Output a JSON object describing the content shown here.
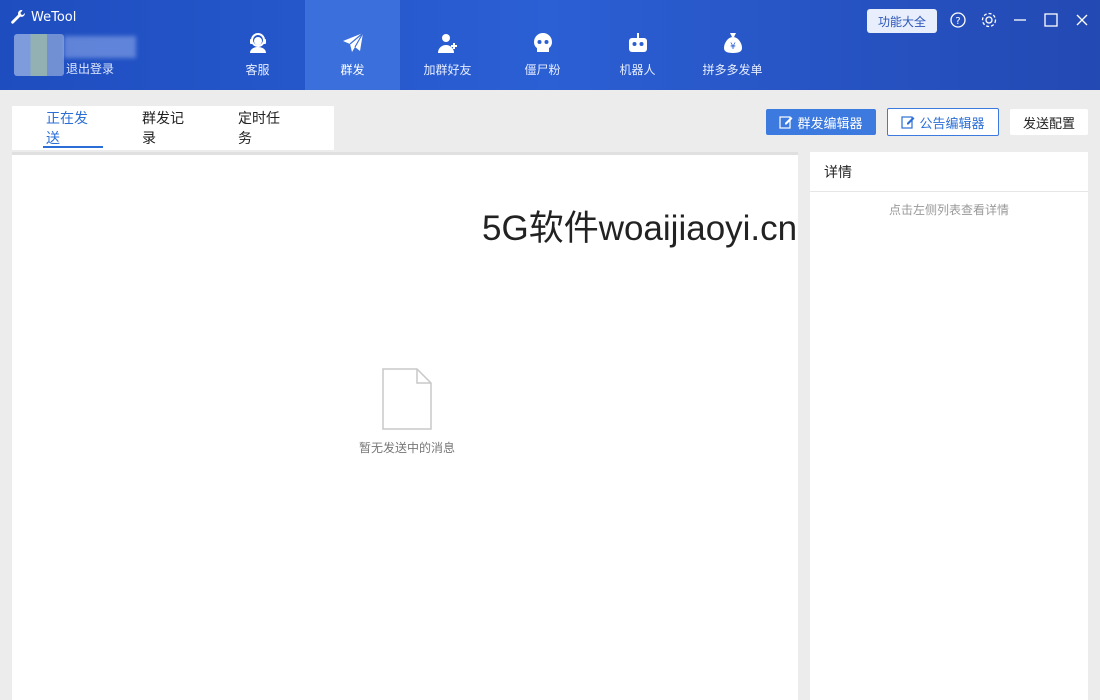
{
  "app": {
    "title": "WeTool",
    "logout": "退出登录"
  },
  "nav": [
    {
      "label": "客服",
      "icon": "customer-service-icon"
    },
    {
      "label": "群发",
      "icon": "paper-plane-icon"
    },
    {
      "label": "加群好友",
      "icon": "add-user-icon"
    },
    {
      "label": "僵尸粉",
      "icon": "skull-icon"
    },
    {
      "label": "机器人",
      "icon": "robot-icon"
    },
    {
      "label": "拼多多发单",
      "icon": "money-bag-icon"
    }
  ],
  "header_buttons": {
    "features": "功能大全"
  },
  "tabs": [
    {
      "label": "正在发送"
    },
    {
      "label": "群发记录"
    },
    {
      "label": "定时任务"
    }
  ],
  "toolbar": {
    "mass_editor": "群发编辑器",
    "notice_editor": "公告编辑器",
    "send_config": "发送配置"
  },
  "main": {
    "empty_text": "暂无发送中的消息"
  },
  "watermark": "5G软件woaijiaoyi.cn",
  "detail": {
    "title": "详情",
    "hint": "点击左侧列表查看详情"
  },
  "colors": {
    "header": "#2b5fd4",
    "accent": "#3c7ae0",
    "active_tab": "#2b6fd6"
  }
}
